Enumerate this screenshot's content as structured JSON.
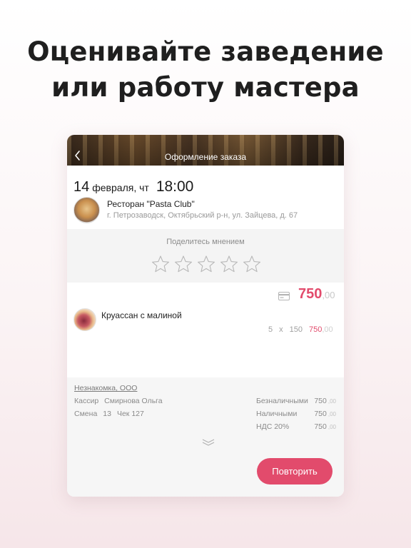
{
  "headline": {
    "line1": "Оценивайте заведение",
    "line2": "или работу мастера"
  },
  "header": {
    "title": "Оформление заказа",
    "back_icon": "chevron-left-icon"
  },
  "order": {
    "day": "14",
    "month_weekday": "февраля, чт",
    "time": "18:00"
  },
  "restaurant": {
    "name": "Ресторан \"Pasta Club\"",
    "address": "г. Петрозаводск, Октябрьский р-н, ул. Зайцева, д. 67"
  },
  "rating": {
    "label": "Поделитесь мнением",
    "stars_max": 5,
    "stars_selected": 0,
    "star_icon": "star-outline-icon"
  },
  "total": {
    "payment_icon": "card-icon",
    "main": "750",
    "decimal": ",00"
  },
  "item": {
    "name": "Круассан с малиной",
    "qty": "5",
    "times": "x",
    "price": "150",
    "sum": "750",
    "sum_decimal": ",00"
  },
  "receipt": {
    "company": "Незнакомка, ООО",
    "cashier_label": "Кассир",
    "cashier_name": "Смирнова Ольга",
    "shift_label": "Смена",
    "shift_number": "13",
    "check_label": "Чек 127",
    "rows": [
      {
        "label": "Безналичными",
        "value": "750",
        "decimal": ",00"
      },
      {
        "label": "Наличными",
        "value": "750",
        "decimal": ",00"
      },
      {
        "label": "НДС 20%",
        "value": "750",
        "decimal": ",00"
      }
    ],
    "expand_icon": "double-chevron-down-icon"
  },
  "actions": {
    "repeat_label": "Повторить"
  },
  "colors": {
    "accent": "#e24b6c",
    "muted": "#9a9a9a"
  }
}
